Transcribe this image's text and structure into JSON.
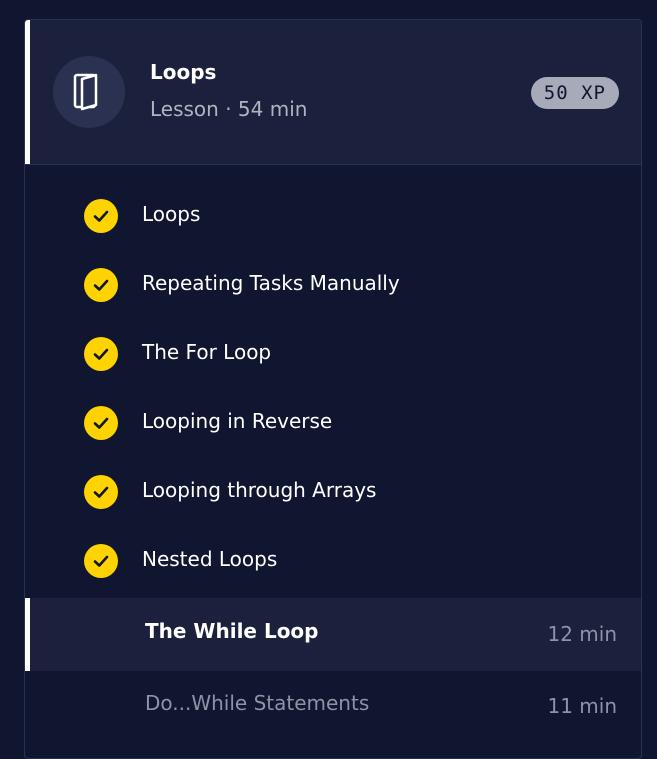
{
  "lesson": {
    "title": "Loops",
    "subtitle": "Lesson · 54 min",
    "xp": "50 XP",
    "icon": "book-icon"
  },
  "completed_items": [
    {
      "label": "Loops",
      "status": "completed"
    },
    {
      "label": "Repeating Tasks Manually",
      "status": "completed"
    },
    {
      "label": "The For Loop",
      "status": "completed"
    },
    {
      "label": "Looping in Reverse",
      "status": "completed"
    },
    {
      "label": "Looping through Arrays",
      "status": "completed"
    },
    {
      "label": "Nested Loops",
      "status": "completed"
    }
  ],
  "current_item": {
    "label": "The While Loop",
    "duration": "12 min"
  },
  "next_item": {
    "label": "Do...While Statements",
    "duration": "11 min"
  },
  "colors": {
    "background": "#10162f",
    "header_background": "#1b213c",
    "check": "#ffd300",
    "badge": "#a7aab8",
    "text_muted": "#8e92a6"
  }
}
